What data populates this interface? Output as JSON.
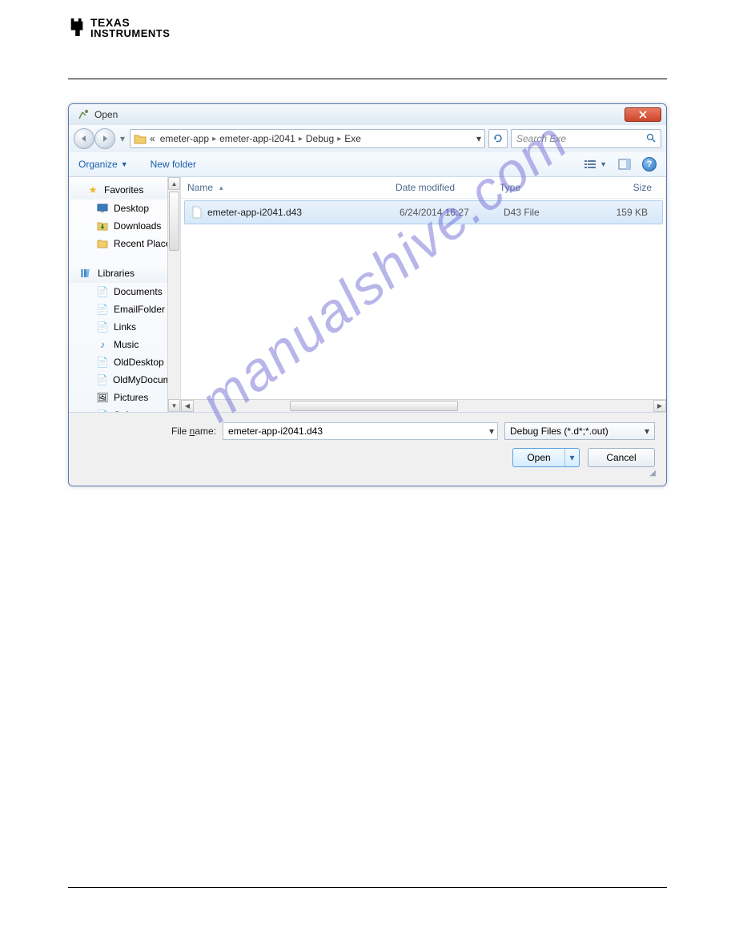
{
  "branding": {
    "line1": "TEXAS",
    "line2": "INSTRUMENTS"
  },
  "watermark": "manualshive.com",
  "dialog": {
    "title": "Open",
    "breadcrumb": {
      "prefix": "«",
      "items": [
        "emeter-app",
        "emeter-app-i2041",
        "Debug",
        "Exe"
      ]
    },
    "search_placeholder": "Search Exe",
    "toolbar": {
      "organize": "Organize",
      "newfolder": "New folder"
    },
    "navpane": {
      "favorites": {
        "label": "Favorites",
        "items": [
          "Desktop",
          "Downloads",
          "Recent Places"
        ]
      },
      "libraries": {
        "label": "Libraries",
        "items": [
          "Documents",
          "EmailFolder",
          "Links",
          "Music",
          "OldDesktop",
          "OldMyDocument",
          "Pictures",
          "Software"
        ]
      }
    },
    "columns": {
      "name": "Name",
      "date": "Date modified",
      "type": "Type",
      "size": "Size"
    },
    "files": [
      {
        "name": "emeter-app-i2041.d43",
        "date": "6/24/2014 16:27",
        "type": "D43 File",
        "size": "159 KB"
      }
    ],
    "filename_label": "File name:",
    "filename_value": "emeter-app-i2041.d43",
    "filter_value": "Debug Files (*.d*;*.out)",
    "open_btn": "Open",
    "cancel_btn": "Cancel"
  }
}
